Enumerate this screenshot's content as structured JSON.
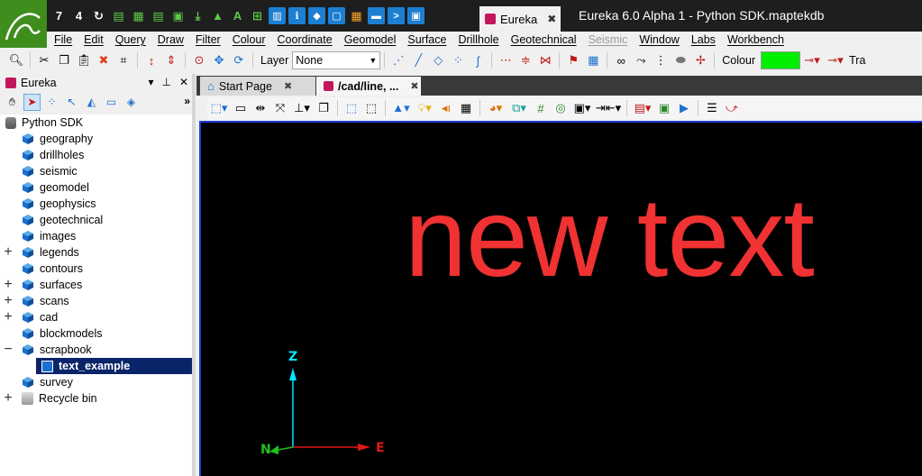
{
  "window": {
    "app_title": "Eureka 6.0 Alpha 1 - Python SDK.maptekdb",
    "tab_label": "Eureka",
    "tab_close": "✖"
  },
  "menu": [
    "File",
    "Edit",
    "Query",
    "Draw",
    "Filter",
    "Colour",
    "Coordinate",
    "Geomodel",
    "Surface",
    "Drillhole",
    "Geotechnical",
    "Seismic",
    "Window",
    "Labs",
    "Workbench"
  ],
  "menu_disabled": [
    "Seismic"
  ],
  "toolbar": {
    "layer_label": "Layer",
    "layer_value": "None",
    "colour_label": "Colour",
    "colour_value": "#00ee00",
    "trailing_label": "Tra"
  },
  "panel": {
    "title": "Eureka",
    "pin": "⊓",
    "close": "✕",
    "dropdown": "▾",
    "more": "»"
  },
  "tree": {
    "root": "Python SDK",
    "items": [
      {
        "label": "geography",
        "expand": ""
      },
      {
        "label": "drillholes",
        "expand": ""
      },
      {
        "label": "seismic",
        "expand": ""
      },
      {
        "label": "geomodel",
        "expand": ""
      },
      {
        "label": "geophysics",
        "expand": ""
      },
      {
        "label": "geotechnical",
        "expand": ""
      },
      {
        "label": "images",
        "expand": ""
      },
      {
        "label": "legends",
        "expand": "+"
      },
      {
        "label": "contours",
        "expand": ""
      },
      {
        "label": "surfaces",
        "expand": "+"
      },
      {
        "label": "scans",
        "expand": "+"
      },
      {
        "label": "cad",
        "expand": "+"
      },
      {
        "label": "blockmodels",
        "expand": ""
      },
      {
        "label": "scrapbook",
        "expand": "−"
      },
      {
        "label": "text_example",
        "expand": "",
        "selected": true,
        "child": true
      },
      {
        "label": "survey",
        "expand": ""
      },
      {
        "label": "Recycle bin",
        "expand": "+",
        "bin": true
      }
    ]
  },
  "doc_tabs": [
    {
      "label": "Start Page",
      "active": false
    },
    {
      "label": "/cad/line, ...",
      "active": true
    }
  ],
  "viewport": {
    "text": "new text",
    "text_color": "#f03232",
    "axis_z": "Z",
    "axis_n": "N",
    "axis_e": "E"
  }
}
